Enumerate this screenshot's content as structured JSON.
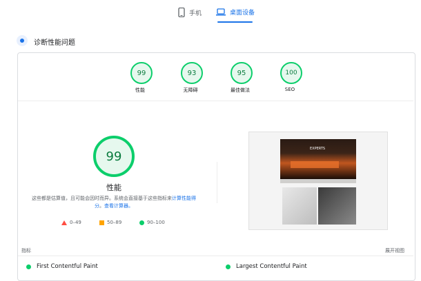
{
  "tabs": [
    {
      "label": "手机",
      "icon": "phone-icon",
      "active": false
    },
    {
      "label": "桌面设备",
      "icon": "laptop-icon",
      "active": true
    }
  ],
  "section": {
    "title": "诊断性能问题",
    "icon": "bolt-icon"
  },
  "scores": [
    {
      "value": "99",
      "label": "性能"
    },
    {
      "value": "93",
      "label": "无障碍"
    },
    {
      "value": "95",
      "label": "最佳做法"
    },
    {
      "value": "100",
      "label": "SEO"
    }
  ],
  "main_score": {
    "value": "99",
    "label": "性能"
  },
  "description": {
    "text": "这些都是估算值，且可能会因时而异。系统会直接基于这些指标来",
    "link1": "计算性能得分",
    "middle": "。",
    "link2": "查看计算器。"
  },
  "legend": [
    {
      "shape": "triangle",
      "color": "#ff4e42",
      "label": "0–49"
    },
    {
      "shape": "square",
      "color": "#ffa400",
      "label": "50–89"
    },
    {
      "shape": "circle",
      "color": "#0cce6b",
      "label": "90–100"
    }
  ],
  "metrics_header": {
    "title": "指标",
    "expand": "展开视图"
  },
  "metrics": [
    {
      "name": "First Contentful Paint"
    },
    {
      "name": "Largest Contentful Paint"
    }
  ],
  "screenshot": {
    "text": "EXPERTS"
  },
  "colors": {
    "accent": "#1a73e8",
    "pass": "#0cce6b"
  }
}
